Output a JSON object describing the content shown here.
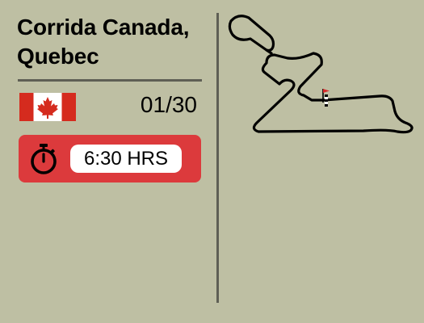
{
  "race": {
    "title_line1": "Corrida Canada,",
    "title_line2": "Quebec",
    "round": "01/30",
    "flag_icon": "canada-flag-icon",
    "flag_colors": {
      "red": "#d52b1e",
      "white": "#ffffff"
    }
  },
  "timer": {
    "icon": "stopwatch-icon",
    "duration": "6:30 HRS",
    "accent_color": "#dc3a3c"
  },
  "circuit": {
    "icon": "circuit-map-icon",
    "finish_flag_color": "#d62a2a"
  },
  "theme": {
    "background": "#bebfa3",
    "divider": "#5f5f55"
  }
}
